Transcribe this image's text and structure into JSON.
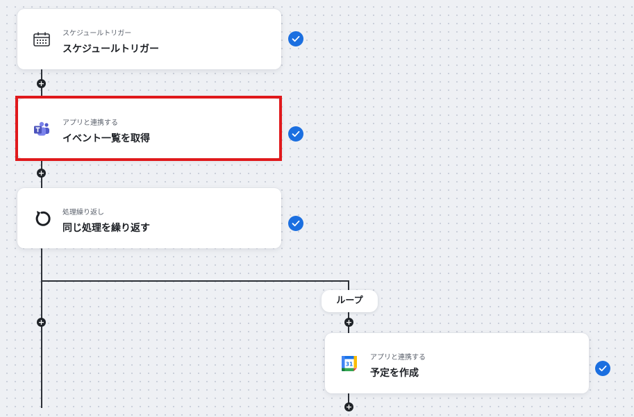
{
  "flow": {
    "steps": [
      {
        "type_label": "スケジュールトリガー",
        "title": "スケジュールトリガー",
        "icon": "calendar-clock-icon",
        "status": "completed"
      },
      {
        "type_label": "アプリと連携する",
        "title": "イベント一覧を取得",
        "icon": "microsoft-teams-icon",
        "status": "completed",
        "highlighted": true
      },
      {
        "type_label": "処理繰り返し",
        "title": "同じ処理を繰り返す",
        "icon": "loop-icon",
        "status": "completed"
      },
      {
        "type_label": "アプリと連携する",
        "title": "予定を作成",
        "icon": "google-calendar-icon",
        "icon_text": "31",
        "status": "completed"
      }
    ],
    "loop_label": "ループ",
    "add_step_symbol": "+"
  },
  "colors": {
    "check_blue": "#1b6fe0",
    "highlight_red": "#e0191c",
    "teams_purple": "#5059c9",
    "connector": "#2b2f36"
  }
}
